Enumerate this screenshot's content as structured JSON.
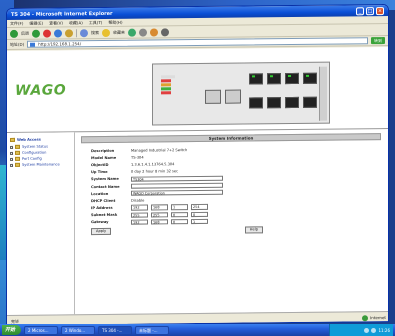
{
  "window": {
    "title": "TS 304 - Microsoft Internet Explorer"
  },
  "menu": [
    "文件(F)",
    "编辑(E)",
    "查看(V)",
    "收藏(A)",
    "工具(T)",
    "帮助(H)"
  ],
  "toolbar": {
    "back_label": "后退",
    "search_label": "搜索",
    "favorites_label": "收藏夹"
  },
  "address": {
    "label": "地址(D)",
    "value": "http://192.168.1.254/",
    "go_label": "转到"
  },
  "header": {
    "logo_text": "WAGO"
  },
  "sidebar": {
    "root": "Web Access",
    "items": [
      {
        "label": "System Status"
      },
      {
        "label": "Configuration"
      },
      {
        "label": "Port Config"
      },
      {
        "label": "System Maintenance"
      }
    ]
  },
  "main": {
    "title": "System Information",
    "rows": [
      {
        "label": "Description",
        "value": "Managed Industrial 7+2 Switch"
      },
      {
        "label": "Model Name",
        "value": "TS-304"
      },
      {
        "label": "ObjectID",
        "value": "1.3.6.1.4.1.13764.5.304"
      },
      {
        "label": "Up Time",
        "value": "0 day 2 hour 8 min 32 sec"
      }
    ],
    "fields": [
      {
        "label": "System Name",
        "value": "TS304"
      },
      {
        "label": "Contact Name",
        "value": ""
      },
      {
        "label": "Location",
        "value": "WAGO Corporation"
      }
    ],
    "dhcp": {
      "label": "DHCP Client",
      "value": "Disable"
    },
    "ip_rows": [
      {
        "label": "IP Address",
        "octets": [
          "192",
          "168",
          "1",
          "254"
        ]
      },
      {
        "label": "Subnet Mask",
        "octets": [
          "255",
          "255",
          "0",
          "0"
        ]
      },
      {
        "label": "Gateway",
        "octets": [
          "192",
          "168",
          "0",
          "1"
        ]
      }
    ],
    "apply_label": "Apply",
    "help_label": "Help"
  },
  "status": {
    "left": "完毕",
    "zone": "Internet"
  },
  "taskbar": {
    "start_label": "开始",
    "tasks": [
      "2 Micros...",
      "2 Windo...",
      "TS 304 -...",
      "未标题 -..."
    ],
    "clock": "11:26"
  }
}
